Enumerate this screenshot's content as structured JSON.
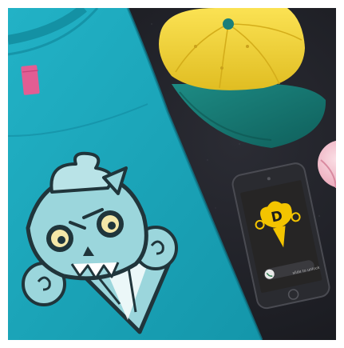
{
  "image": {
    "width": 431,
    "height": 435,
    "kind": "product mockup photograph",
    "background_color": "#ffffff",
    "surface_color": "#23242b"
  },
  "tshirt": {
    "color": "#1aa9bf",
    "tag_color": "#e25d93",
    "graphic": "ice-cream-cone-skull-character",
    "graphic_colors": [
      "#9bd6dc",
      "#20353b",
      "#f4e7a8",
      "#ffffff"
    ]
  },
  "cap": {
    "crown_color": "#f4d53b",
    "brim_color": "#1b7f7a",
    "button_color": "#1b7f7a"
  },
  "phone": {
    "body_color": "#2a2b30",
    "screen_color": "#262525",
    "logo_letter": "D",
    "logo_color": "#f3c400",
    "caption_text": "slide to unlock",
    "unlock_icon": "phone-call-icon"
  },
  "ball": {
    "colors": [
      "#f2b8c7",
      "#f7d9df"
    ]
  }
}
